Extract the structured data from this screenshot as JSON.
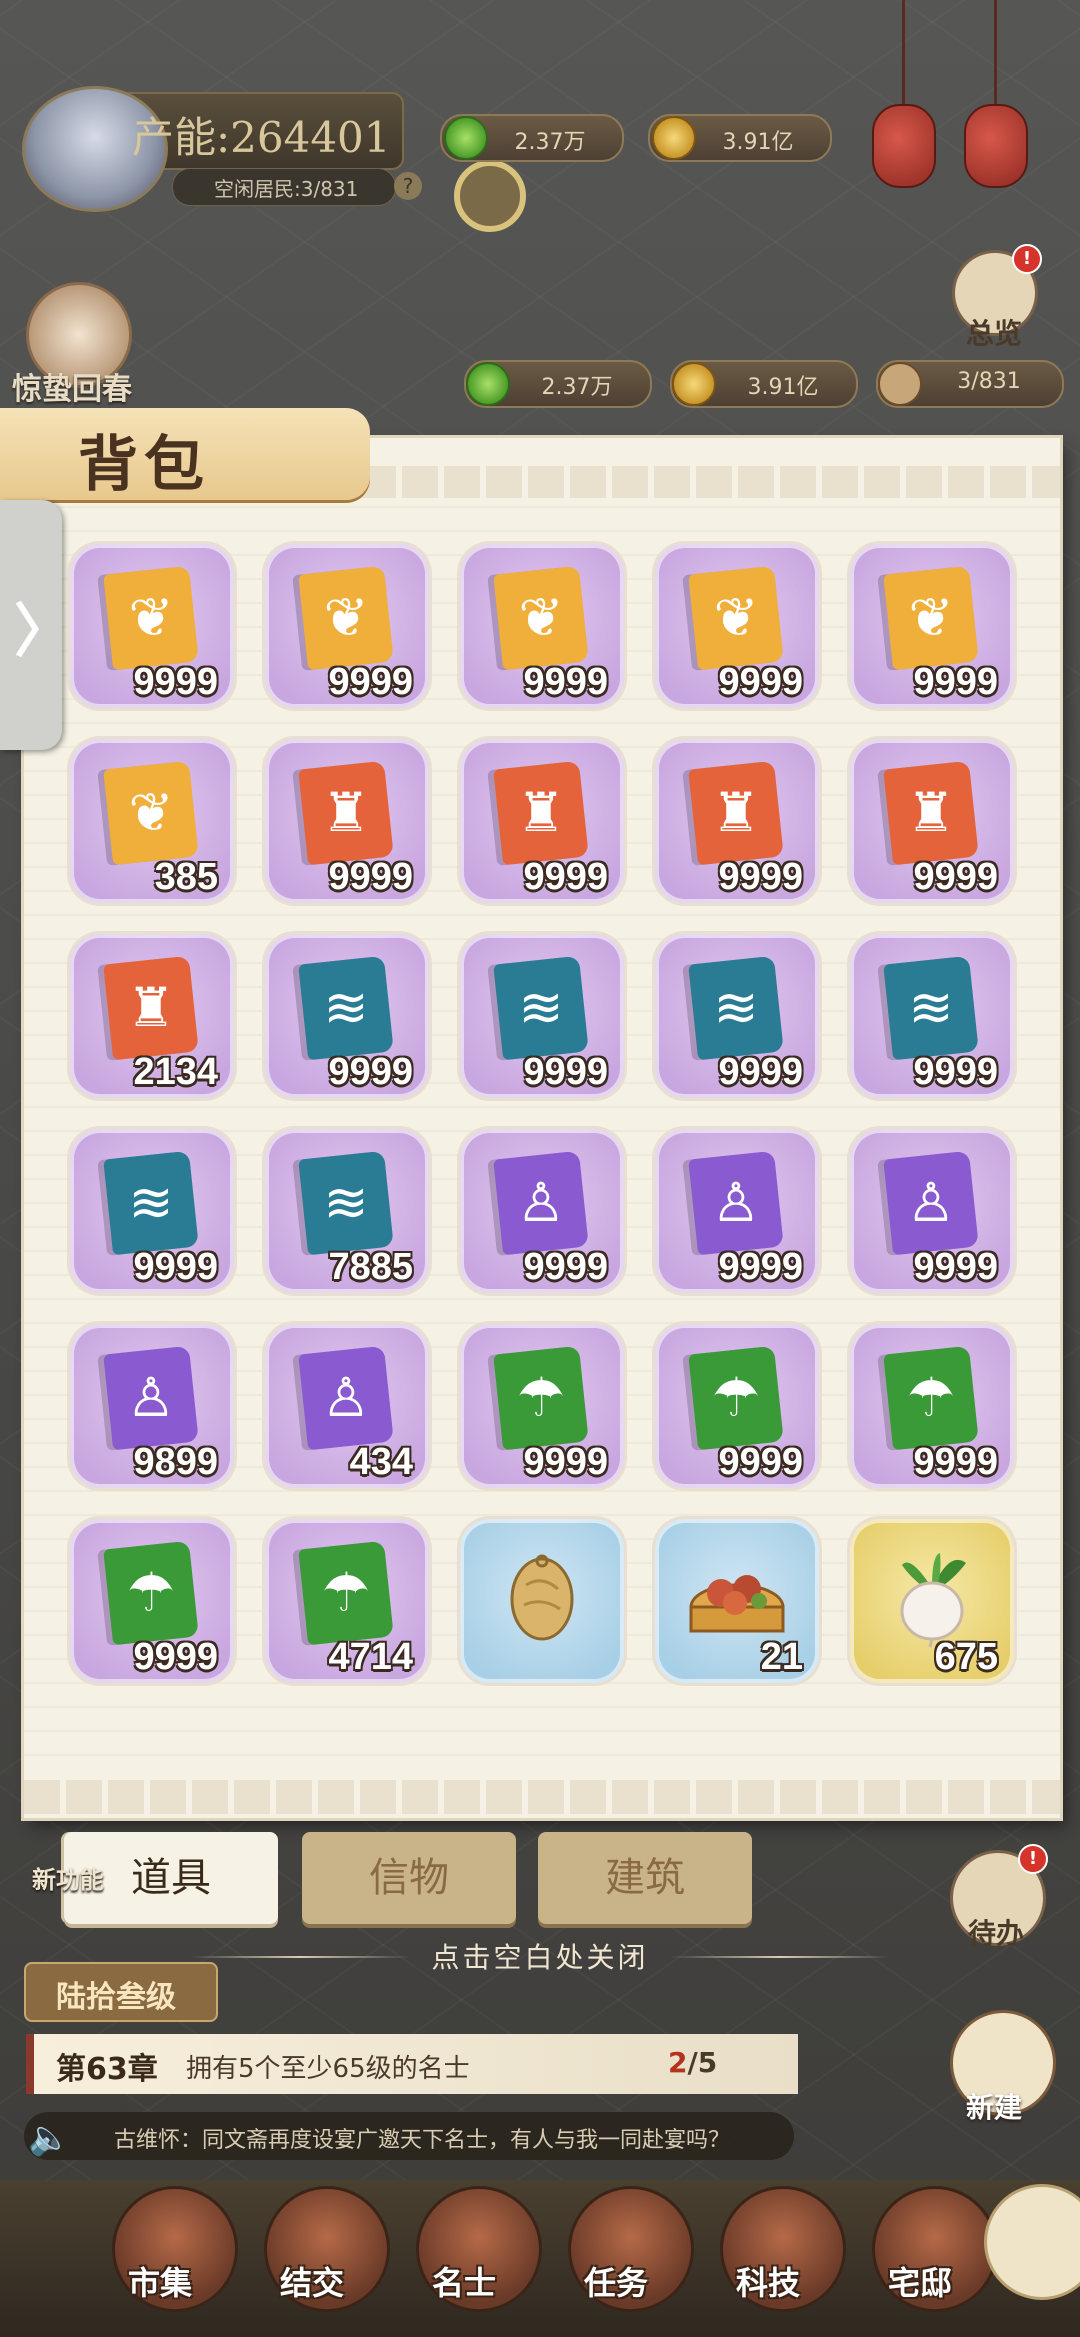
{
  "hud": {
    "production_label": "产能:",
    "production_value": "264401",
    "idle_residents": "空闲居民:3/831",
    "help_icon": "?",
    "currency_top": [
      "2.37万",
      "3.91亿"
    ],
    "event_label": "惊蛰回春",
    "overview_label": "总览",
    "overview_badge": "!",
    "currency_row": [
      "2.37万",
      "3.91亿",
      "3/831"
    ]
  },
  "panel": {
    "title": "背包",
    "handle_glyph": "〉",
    "items": [
      {
        "type": "wheat",
        "frame": "purple",
        "count": "9999"
      },
      {
        "type": "wheat",
        "frame": "purple",
        "count": "9999"
      },
      {
        "type": "wheat",
        "frame": "purple",
        "count": "9999"
      },
      {
        "type": "wheat",
        "frame": "purple",
        "count": "9999"
      },
      {
        "type": "wheat",
        "frame": "purple",
        "count": "9999"
      },
      {
        "type": "wheat",
        "frame": "purple",
        "count": "385"
      },
      {
        "type": "drum",
        "frame": "purple",
        "count": "9999"
      },
      {
        "type": "drum",
        "frame": "purple",
        "count": "9999"
      },
      {
        "type": "drum",
        "frame": "purple",
        "count": "9999"
      },
      {
        "type": "drum",
        "frame": "purple",
        "count": "9999"
      },
      {
        "type": "drum",
        "frame": "purple",
        "count": "2134"
      },
      {
        "type": "cloth",
        "frame": "purple",
        "count": "9999"
      },
      {
        "type": "cloth",
        "frame": "purple",
        "count": "9999"
      },
      {
        "type": "cloth",
        "frame": "purple",
        "count": "9999"
      },
      {
        "type": "cloth",
        "frame": "purple",
        "count": "9999"
      },
      {
        "type": "cloth",
        "frame": "purple",
        "count": "9999"
      },
      {
        "type": "cloth",
        "frame": "purple",
        "count": "7885"
      },
      {
        "type": "robe",
        "frame": "purple",
        "count": "9999"
      },
      {
        "type": "robe",
        "frame": "purple",
        "count": "9999"
      },
      {
        "type": "robe",
        "frame": "purple",
        "count": "9999"
      },
      {
        "type": "robe",
        "frame": "purple",
        "count": "9899"
      },
      {
        "type": "robe",
        "frame": "purple",
        "count": "434"
      },
      {
        "type": "umbrella",
        "frame": "purple",
        "count": "9999"
      },
      {
        "type": "umbrella",
        "frame": "purple",
        "count": "9999"
      },
      {
        "type": "umbrella",
        "frame": "purple",
        "count": "9999"
      },
      {
        "type": "umbrella",
        "frame": "purple",
        "count": "9999"
      },
      {
        "type": "umbrella",
        "frame": "purple",
        "count": "4714"
      },
      {
        "type": "bread",
        "frame": "blue",
        "count": ""
      },
      {
        "type": "dumplings",
        "frame": "blue",
        "count": "21"
      },
      {
        "type": "radish",
        "frame": "gold",
        "count": "675"
      }
    ],
    "tabs": [
      "道具",
      "信物",
      "建筑"
    ],
    "close_hint": "点击空白处关闭"
  },
  "bottom": {
    "new_feature": "新功能",
    "todo_label": "待办",
    "todo_badge": "!",
    "level": "陆拾叁级",
    "chapter_no": "第63章",
    "chapter_desc": "拥有5个至少65级的名士",
    "chapter_done": "2",
    "chapter_total": "/5",
    "new_build": "新建",
    "news_icon": "speaker-icon",
    "news": "古维怀：同文斋再度设宴广邀天下名士，有人与我一同赴宴吗？",
    "dock": [
      "市集",
      "结交",
      "名士",
      "任务",
      "科技",
      "宅邸"
    ]
  },
  "colors": {
    "frame_purple": "#c8a6df",
    "frame_blue": "#a7cfe6",
    "frame_gold": "#e6ce6a",
    "book_wheat": "#f0ae3a",
    "book_drum": "#e5633a",
    "book_cloth": "#2a7c95",
    "book_robe": "#8a5ad0",
    "book_umbrella": "#3a9a38"
  }
}
